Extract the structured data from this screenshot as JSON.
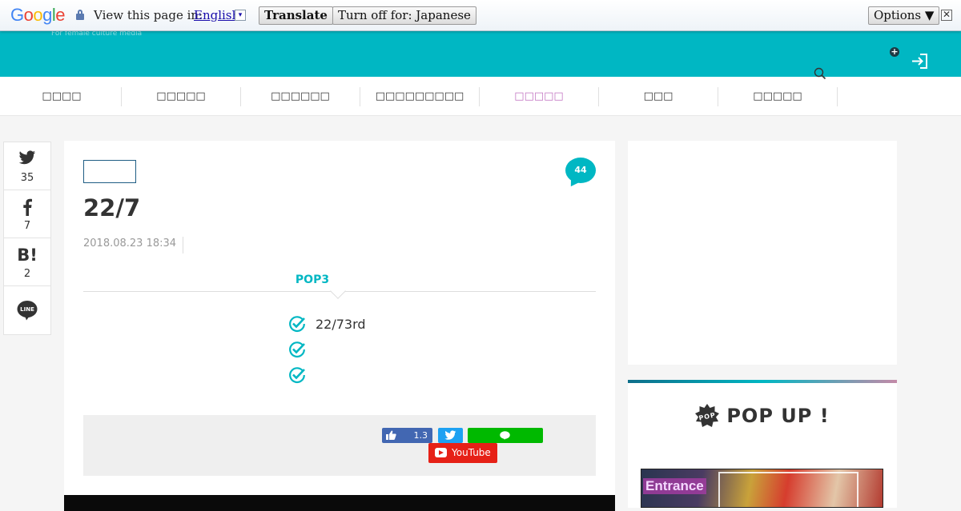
{
  "translate_bar": {
    "logo": [
      "G",
      "o",
      "o",
      "g",
      "l",
      "e"
    ],
    "view_label": "View this page in:",
    "language": "English",
    "lang_arrow": "▾",
    "translate_label": "Translate",
    "turn_off_label": "Turn off for: Japanese",
    "options_label": "Options ▼",
    "close_glyph": "✕"
  },
  "header": {
    "tagline": "For female culture media",
    "accent_color": "#00b7c3",
    "plus_glyph": "+"
  },
  "nav": {
    "items": [
      {
        "label": "□□□□"
      },
      {
        "label": "□□□□□"
      },
      {
        "label": "□□□□□□"
      },
      {
        "label": "□□□□□□□□□"
      },
      {
        "label": "□□□□□",
        "active": true
      },
      {
        "label": "□□□"
      },
      {
        "label": "□□□□□"
      }
    ],
    "active_color": "#c070c0"
  },
  "share_sidebar": {
    "twitter_count": "35",
    "facebook_count": "7",
    "hatena_label": "B!",
    "hatena_count": "2",
    "line_label": "LINE"
  },
  "article": {
    "comment_count": "44",
    "title": "22/7",
    "date": "2018.08.23 18:34",
    "pop_heading": "POP3",
    "points": [
      "22/73rd",
      "",
      ""
    ],
    "like_count": "1.3",
    "youtube_label": "YouTube"
  },
  "sidebar": {
    "popup_badge": "POP",
    "popup_title": "POP UP !",
    "thumb_label": "Entrance"
  }
}
